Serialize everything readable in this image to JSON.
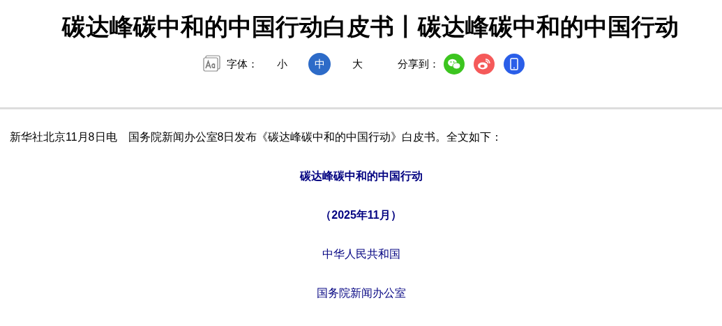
{
  "title": "碳达峰碳中和的中国行动白皮书丨碳达峰碳中和的中国行动",
  "font_size": {
    "label": "字体：",
    "options": [
      {
        "label": "小",
        "selected": false
      },
      {
        "label": "中",
        "selected": true
      },
      {
        "label": "大",
        "selected": false
      }
    ]
  },
  "share": {
    "label": "分享到：",
    "targets": [
      {
        "kind": "wechat"
      },
      {
        "kind": "weibo"
      },
      {
        "kind": "mobile"
      }
    ]
  },
  "paragraphs": [
    {
      "kind": "body",
      "text": "新华社北京11月8日电　国务院新闻办公室8日发布《碳达峰碳中和的中国行动》白皮书。全文如下："
    },
    {
      "kind": "heading",
      "text": "碳达峰碳中和的中国行动"
    },
    {
      "kind": "heading",
      "text": "（2025年11月）"
    },
    {
      "kind": "center",
      "text": "中华人民共和国"
    },
    {
      "kind": "center",
      "text": "国务院新闻办公室"
    }
  ]
}
